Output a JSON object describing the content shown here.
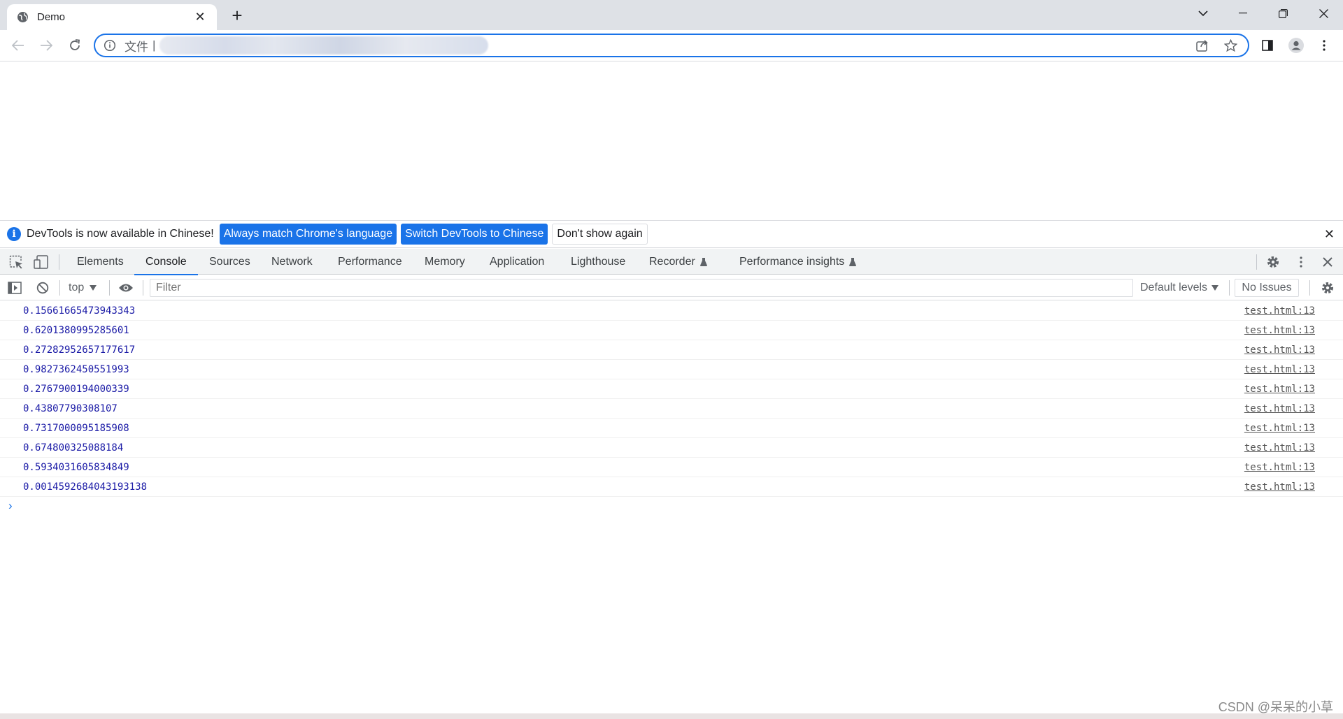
{
  "browser": {
    "tab_title": "Demo",
    "new_tab_label": "+",
    "address_scheme": "文件"
  },
  "devtools": {
    "infobar": {
      "message": "DevTools is now available in Chinese!",
      "btn_match": "Always match Chrome's language",
      "btn_switch": "Switch DevTools to Chinese",
      "btn_dont_show": "Don't show again"
    },
    "tabs": [
      "Elements",
      "Console",
      "Sources",
      "Network",
      "Performance",
      "Memory",
      "Application",
      "Lighthouse",
      "Recorder",
      "Performance insights"
    ],
    "console_bar": {
      "context": "top",
      "filter_placeholder": "Filter",
      "levels": "Default levels",
      "issues": "No Issues"
    },
    "logs": [
      {
        "value": "0.15661665473943343",
        "source": "test.html:13"
      },
      {
        "value": "0.6201380995285601",
        "source": "test.html:13"
      },
      {
        "value": "0.27282952657177617",
        "source": "test.html:13"
      },
      {
        "value": "0.9827362450551993",
        "source": "test.html:13"
      },
      {
        "value": "0.2767900194000339",
        "source": "test.html:13"
      },
      {
        "value": "0.43807790308107",
        "source": "test.html:13"
      },
      {
        "value": "0.7317000095185908",
        "source": "test.html:13"
      },
      {
        "value": "0.674800325088184",
        "source": "test.html:13"
      },
      {
        "value": "0.5934031605834849",
        "source": "test.html:13"
      },
      {
        "value": "0.0014592684043193138",
        "source": "test.html:13"
      }
    ],
    "prompt_caret": "›"
  },
  "watermark": "CSDN @呆呆的小草",
  "colors": {
    "accent": "#1a73e8",
    "log_value": "#1a1aa6",
    "tabstrip": "#dee1e6"
  }
}
